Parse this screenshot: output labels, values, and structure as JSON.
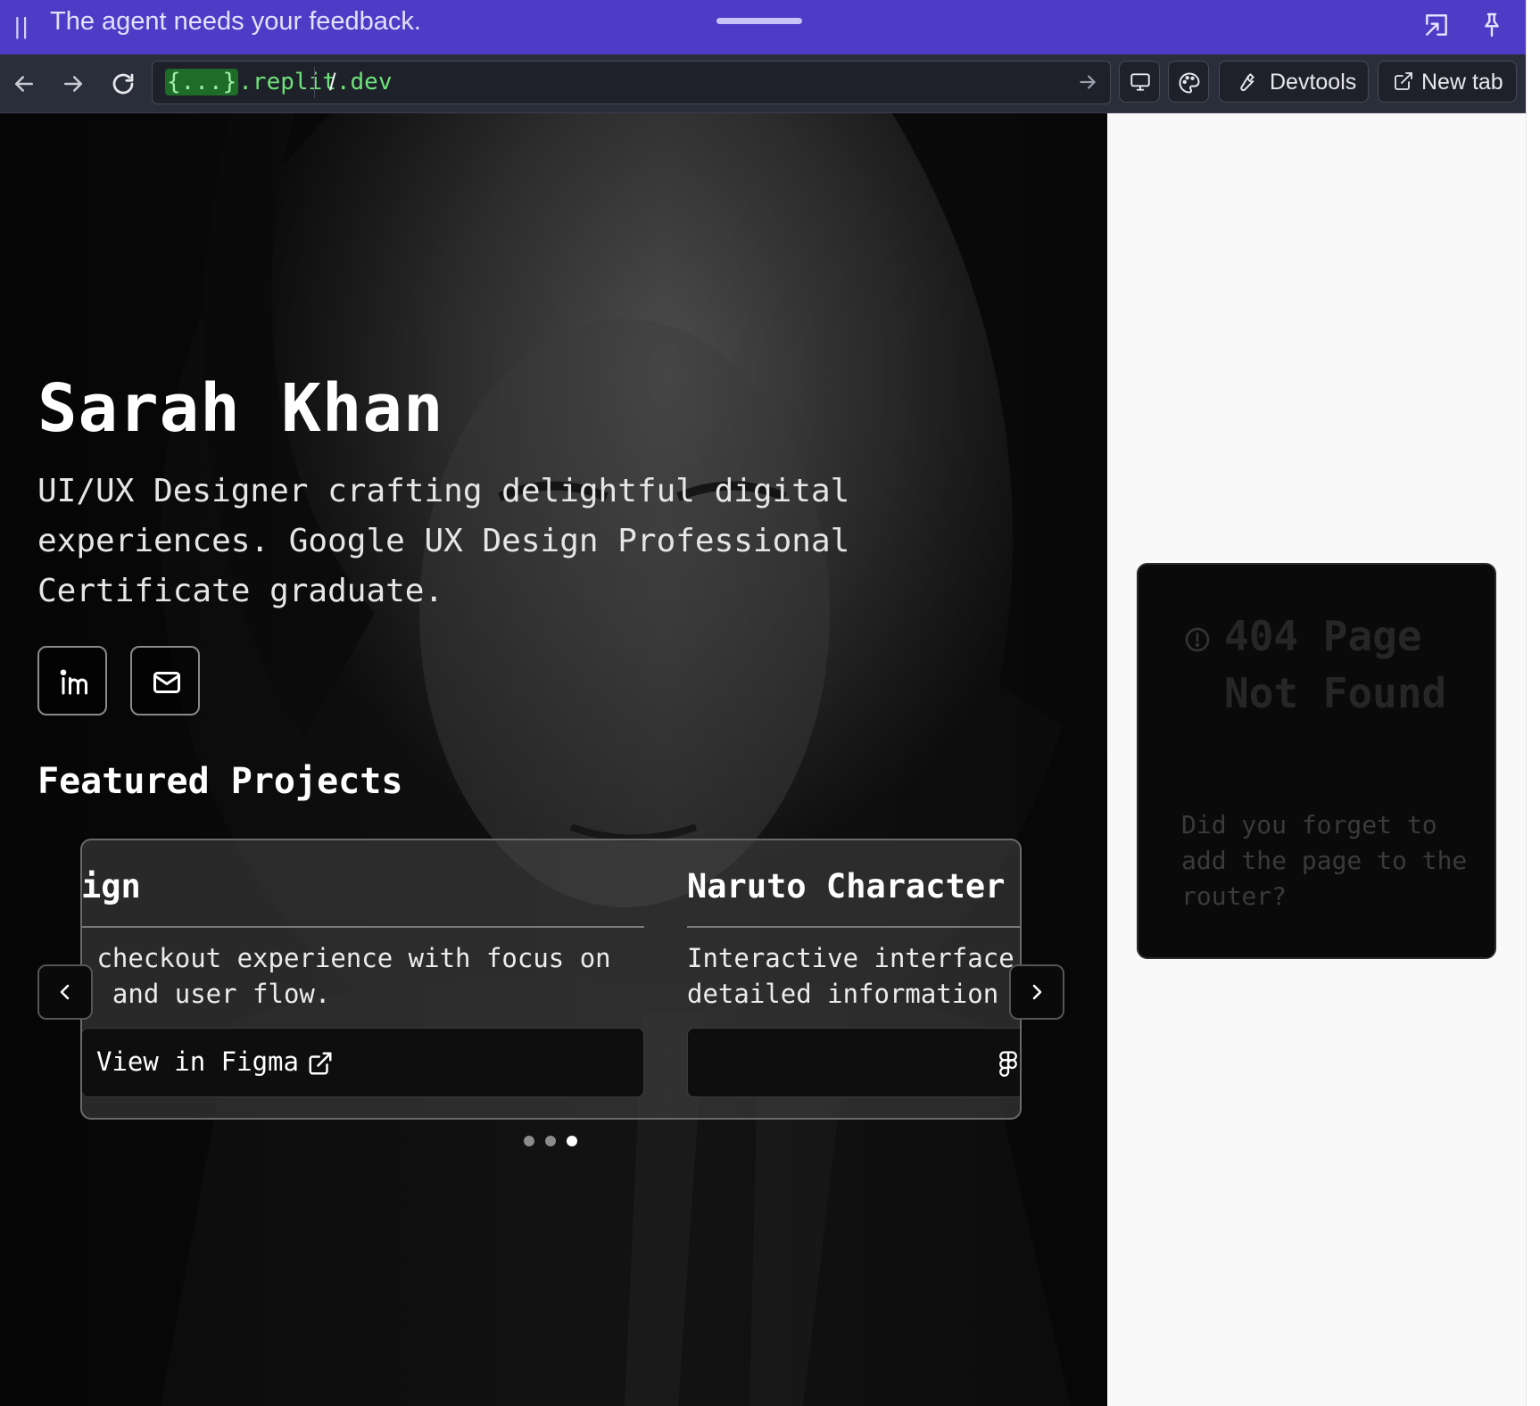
{
  "agent_bar": {
    "message": "The agent needs your feedback.",
    "grip_glyph": "||"
  },
  "toolbar": {
    "url_host_chip": "{...}",
    "url_host_suffix": ".replit.dev",
    "url_path": "/",
    "devtools_label": "Devtools",
    "new_tab_label": "New tab"
  },
  "hero": {
    "name": "Sarah Khan",
    "subtitle": "UI/UX Designer crafting delightful digital experiences. Google UX Design Professional Certificate graduate."
  },
  "featured": {
    "title": "Featured Projects",
    "cards": [
      {
        "title": "ign",
        "description": " checkout experience with focus on\n  and user flow.",
        "button_label": "View in Figma"
      },
      {
        "title": "Naruto Character I",
        "description": "Interactive interface \ndetailed information a",
        "button_label": ""
      }
    ],
    "dots": {
      "count": 3,
      "active_index": 2
    }
  },
  "not_found": {
    "title": "404 Page Not Found",
    "message": "Did you forget to add the page to the router?"
  },
  "colors": {
    "agent_bar": "#4e3cc6",
    "toolbar": "#2a2e3a",
    "url_host": "#6ee37a",
    "page_bg": "#0b0b0b",
    "panel_bg": "#f9f9f9"
  }
}
